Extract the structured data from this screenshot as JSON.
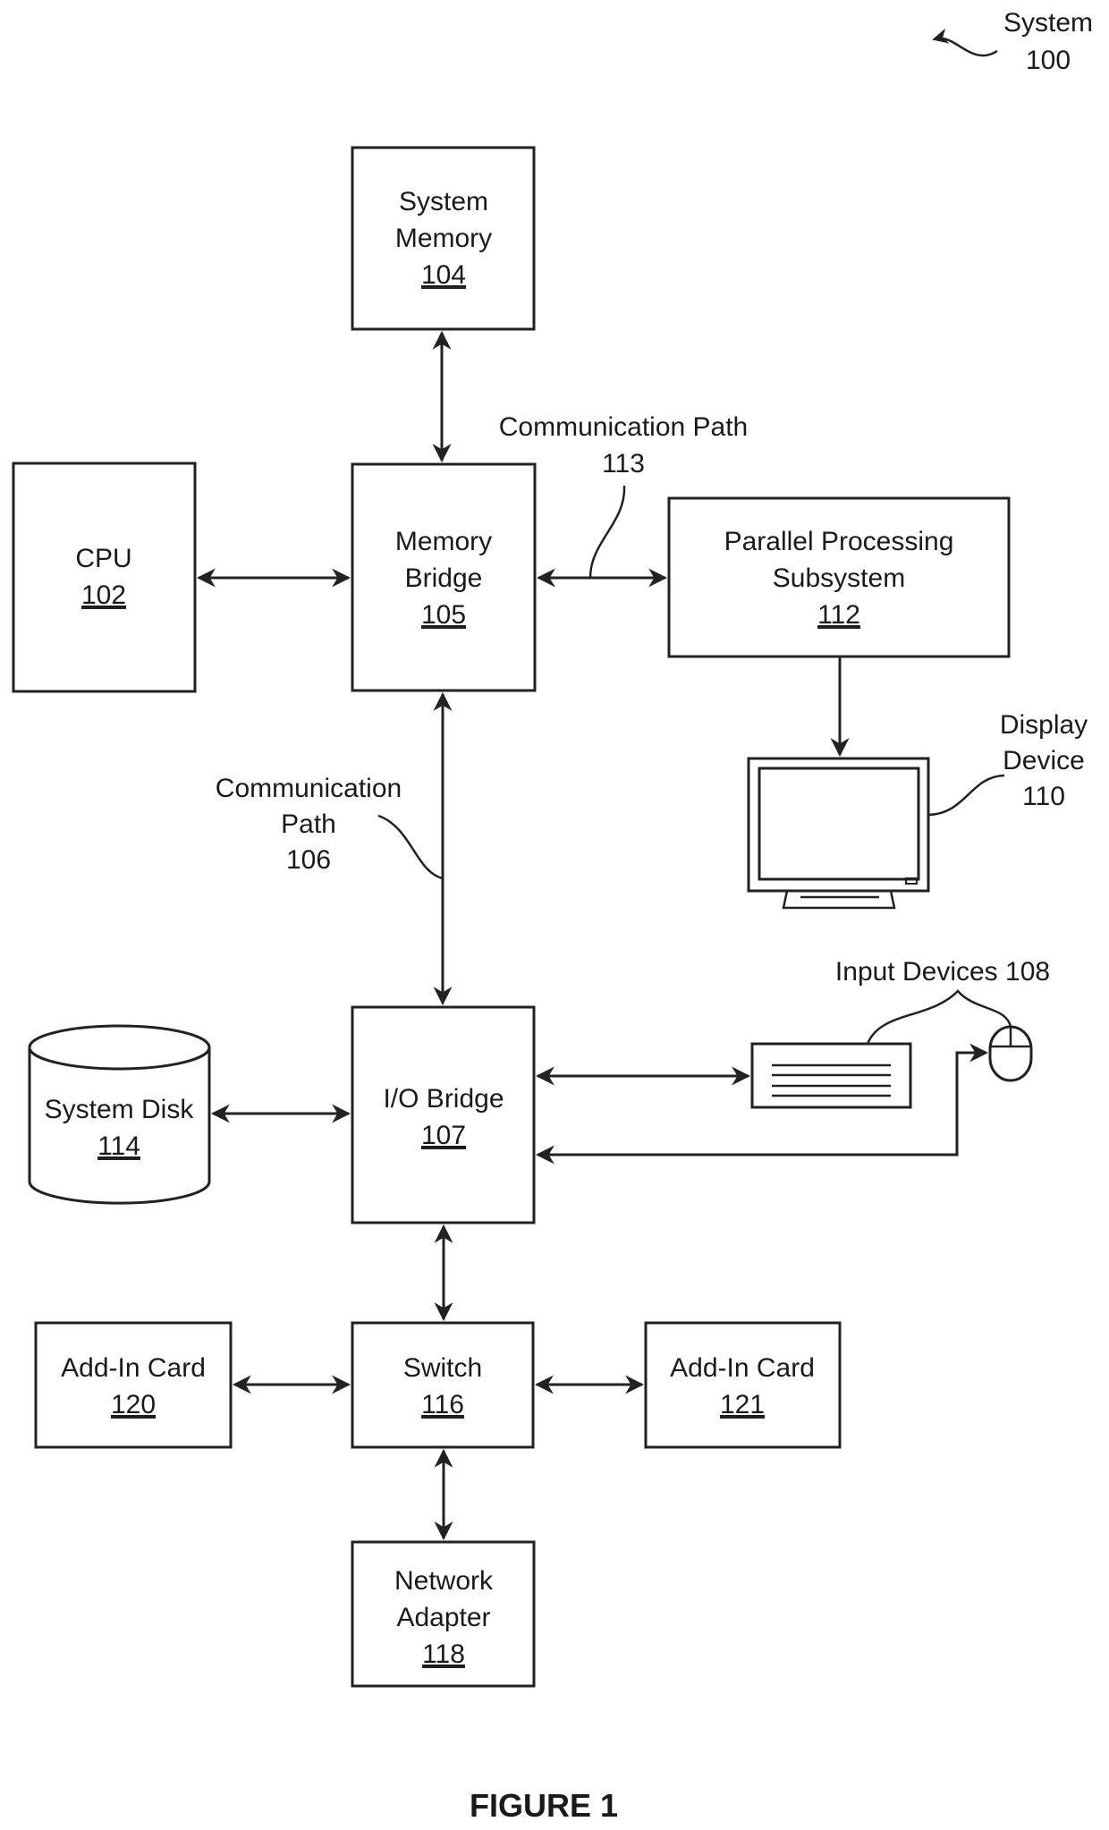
{
  "figure": {
    "title": "FIGURE 1",
    "system_label": "System",
    "system_ref": "100"
  },
  "components": {
    "system_memory": {
      "lines": [
        "System",
        "Memory"
      ],
      "ref": "104"
    },
    "cpu": {
      "lines": [
        "CPU"
      ],
      "ref": "102"
    },
    "memory_bridge": {
      "lines": [
        "Memory",
        "Bridge"
      ],
      "ref": "105"
    },
    "parallel_processing": {
      "lines": [
        "Parallel Processing",
        "Subsystem"
      ],
      "ref": "112"
    },
    "display_device": {
      "lines": [
        "Display",
        "Device"
      ],
      "ref": "110"
    },
    "io_bridge": {
      "lines": [
        "I/O Bridge"
      ],
      "ref": "107"
    },
    "system_disk": {
      "lines": [
        "System Disk"
      ],
      "ref": "114"
    },
    "input_devices": {
      "label": "Input Devices 108"
    },
    "add_in_card_120": {
      "lines": [
        "Add-In Card"
      ],
      "ref": "120"
    },
    "switch": {
      "lines": [
        "Switch"
      ],
      "ref": "116"
    },
    "add_in_card_121": {
      "lines": [
        "Add-In Card"
      ],
      "ref": "121"
    },
    "network_adapter": {
      "lines": [
        "Network",
        "Adapter"
      ],
      "ref": "118"
    }
  },
  "paths": {
    "path_113": {
      "lines": [
        "Communication Path",
        "113"
      ]
    },
    "path_106": {
      "lines": [
        "Communication",
        "Path",
        "106"
      ]
    }
  }
}
